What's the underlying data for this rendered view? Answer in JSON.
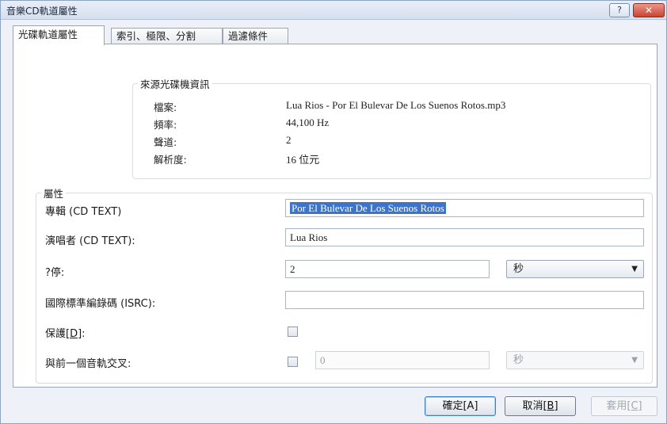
{
  "window": {
    "title": "音樂CD軌道屬性",
    "help_label": "?",
    "close_label": "✕"
  },
  "tabs": [
    {
      "label": "光碟軌道屬性",
      "active": true
    },
    {
      "label": "索引、極限、分割",
      "active": false
    },
    {
      "label": "過濾條件",
      "active": false
    }
  ],
  "source_info": {
    "legend": "來源光碟機資訊",
    "rows": [
      {
        "label": "檔案:",
        "value": "Lua Rios - Por El Bulevar De Los Suenos Rotos.mp3"
      },
      {
        "label": "頻率:",
        "value": "44,100 Hz"
      },
      {
        "label": "聲道:",
        "value": "2"
      },
      {
        "label": "解析度:",
        "value": "16 位元"
      }
    ]
  },
  "attributes": {
    "legend": "屬性",
    "album_label": "專輯 (CD TEXT)",
    "album_value": "Por El Bulevar De Los Suenos Rotos",
    "artist_label": "演唱者 (CD TEXT):",
    "artist_value": "Lua Rios",
    "pause_label": "?停:",
    "pause_value": "2",
    "pause_unit": "秒",
    "isrc_label": "國際標準編錄碼 (ISRC):",
    "isrc_value": "",
    "protect_label_prefix": "保護",
    "protect_label_key": "[D]",
    "protect_label_suffix": ":",
    "crossfade_label": "與前一個音軌交叉:",
    "crossfade_value": "0",
    "crossfade_unit": "秒"
  },
  "buttons": {
    "ok_label": "確定[A]",
    "cancel_prefix": "取消",
    "cancel_key": "[B]",
    "apply_prefix": "套用",
    "apply_key": "[C]"
  },
  "icons": {
    "dropdown": "chevron-down-icon",
    "help": "help-icon",
    "close": "close-icon"
  }
}
